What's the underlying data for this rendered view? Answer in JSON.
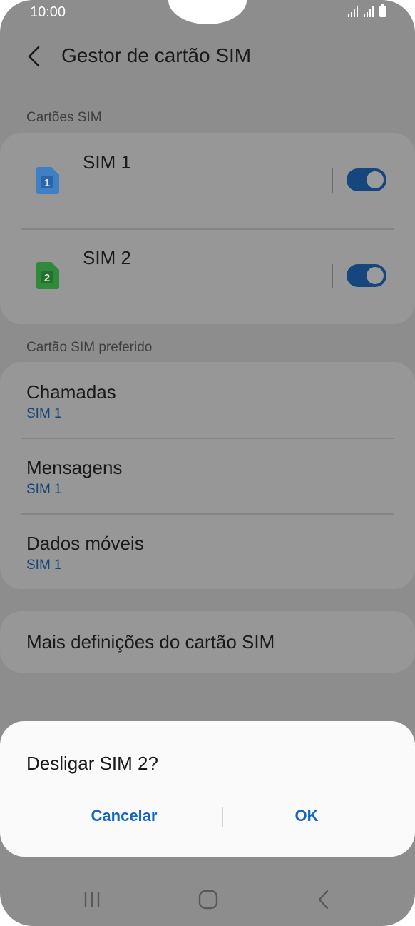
{
  "status_bar": {
    "time": "10:00"
  },
  "header": {
    "title": "Gestor de cartão SIM"
  },
  "sim_cards": {
    "section_label": "Cartões SIM",
    "items": [
      {
        "name": "SIM 1",
        "icon_number": "1",
        "enabled": true,
        "icon_color": "#3f7fc4"
      },
      {
        "name": "SIM 2",
        "icon_number": "2",
        "enabled": true,
        "icon_color": "#2f8a3c"
      }
    ]
  },
  "preferred": {
    "section_label": "Cartão SIM preferido",
    "items": [
      {
        "title": "Chamadas",
        "value": "SIM 1"
      },
      {
        "title": "Mensagens",
        "value": "SIM 1"
      },
      {
        "title": "Dados móveis",
        "value": "SIM 1"
      }
    ]
  },
  "more": {
    "label": "Mais definições do cartão SIM"
  },
  "dialog": {
    "title": "Desligar SIM 2?",
    "cancel_label": "Cancelar",
    "ok_label": "OK"
  },
  "colors": {
    "accent": "#1466c4",
    "scrim_background": "#8d8d8d",
    "dialog_background": "#fafafa"
  },
  "icons": {
    "back": "chevron-left-icon",
    "recents": "recents-icon",
    "home": "home-icon",
    "nav_back": "nav-back-icon"
  }
}
